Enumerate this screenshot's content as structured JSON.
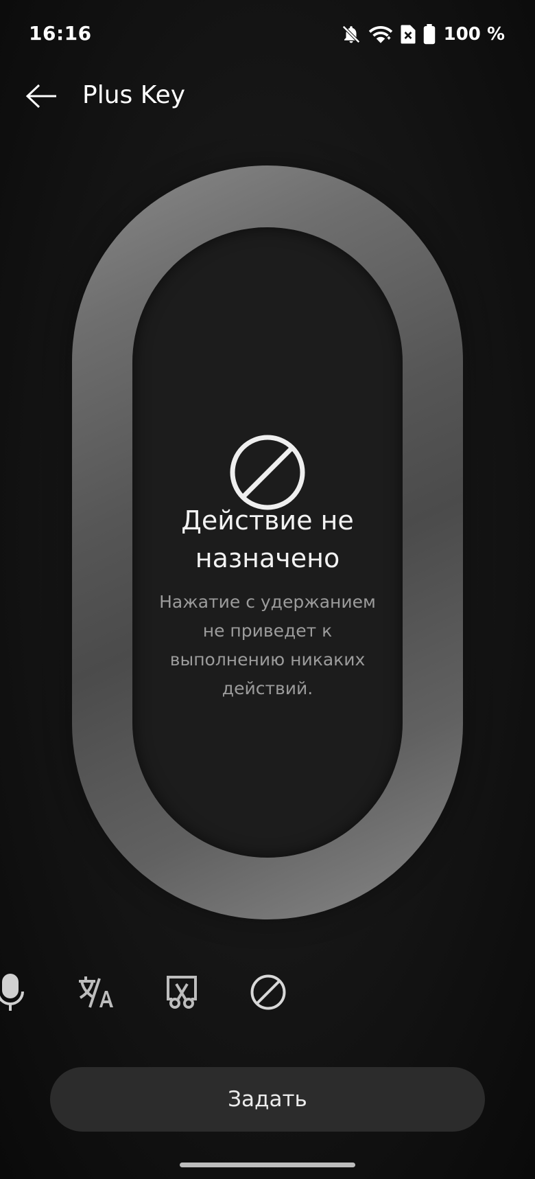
{
  "status_bar": {
    "time": "16:16",
    "battery_percent": "100 %",
    "icons": [
      "bell-off-icon",
      "wifi-icon",
      "sim-off-icon",
      "battery-icon"
    ]
  },
  "app_bar": {
    "title": "Plus Key",
    "back_icon": "arrow-left-icon"
  },
  "key_preview": {
    "icon": "prohibited-icon",
    "title_line1": "Действие не",
    "title_line2": "назначено",
    "description_lines": [
      "Нажатие с удержанием",
      "не приведет к",
      "выполнению никаких",
      "действий."
    ]
  },
  "action_options": [
    {
      "icon": "microphone-icon"
    },
    {
      "icon": "translate-icon"
    },
    {
      "icon": "screenshot-scissors-icon"
    },
    {
      "icon": "prohibited-icon",
      "selected": true
    }
  ],
  "set_button": {
    "label": "Задать"
  },
  "colors": {
    "background": "#141414",
    "key_ring": "#6a6a6a",
    "key_inner": "#1c1c1c",
    "button_bg": "#2c2c2c",
    "description_text": "#9c9c9c"
  }
}
